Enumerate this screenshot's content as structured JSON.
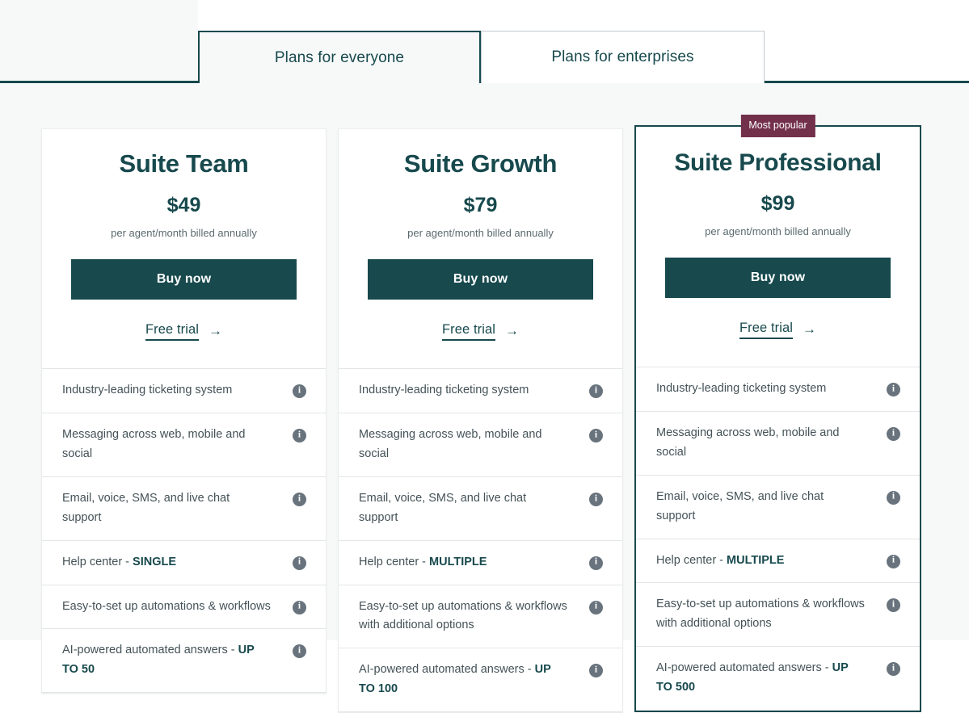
{
  "tabs": [
    {
      "label": "Plans for everyone",
      "active": true
    },
    {
      "label": "Plans for enterprises",
      "active": false
    }
  ],
  "colors": {
    "brand_teal": "#17494d",
    "badge_burgundy": "#73304a",
    "page_background": "#f7f9f9",
    "card_background": "#ffffff",
    "feature_text": "#445257",
    "info_icon": "#68737d",
    "divider": "#e3e6e7"
  },
  "common": {
    "buy_label": "Buy now",
    "trial_label": "Free trial",
    "trial_arrow": "→",
    "price_note": "per agent/month billed annually",
    "info_glyph": "i",
    "badge_label": "Most popular"
  },
  "plans": [
    {
      "name": "Suite Team",
      "price": "$49",
      "price_note": "per agent/month billed annually",
      "buy_label": "Buy now",
      "trial_label": "Free trial",
      "featured": false,
      "features": [
        {
          "text": "Industry-leading ticketing system",
          "strong": ""
        },
        {
          "text": "Messaging across web, mobile and social",
          "strong": ""
        },
        {
          "text": "Email, voice, SMS, and live chat support",
          "strong": ""
        },
        {
          "text": "Help center - ",
          "strong": "SINGLE"
        },
        {
          "text": "Easy-to-set up automations & workflows",
          "strong": ""
        },
        {
          "text": "AI-powered automated answers - ",
          "strong": "UP TO 50"
        }
      ]
    },
    {
      "name": "Suite Growth",
      "price": "$79",
      "price_note": "per agent/month billed annually",
      "buy_label": "Buy now",
      "trial_label": "Free trial",
      "featured": false,
      "features": [
        {
          "text": "Industry-leading ticketing system",
          "strong": ""
        },
        {
          "text": "Messaging across web, mobile and social",
          "strong": ""
        },
        {
          "text": "Email, voice, SMS, and live chat support",
          "strong": ""
        },
        {
          "text": "Help center - ",
          "strong": "MULTIPLE"
        },
        {
          "text": "Easy-to-set up automations & workflows with additional options",
          "strong": ""
        },
        {
          "text": "AI-powered automated answers - ",
          "strong": "UP TO 100"
        }
      ]
    },
    {
      "name": "Suite Professional",
      "price": "$99",
      "price_note": "per agent/month billed annually",
      "buy_label": "Buy now",
      "trial_label": "Free trial",
      "featured": true,
      "badge": "Most popular",
      "features": [
        {
          "text": "Industry-leading ticketing system",
          "strong": ""
        },
        {
          "text": "Messaging across web, mobile and social",
          "strong": ""
        },
        {
          "text": "Email, voice, SMS, and live chat support",
          "strong": ""
        },
        {
          "text": "Help center - ",
          "strong": "MULTIPLE"
        },
        {
          "text": "Easy-to-set up automations & workflows with additional options",
          "strong": ""
        },
        {
          "text": "AI-powered automated answers - ",
          "strong": "UP TO 500"
        }
      ]
    }
  ]
}
